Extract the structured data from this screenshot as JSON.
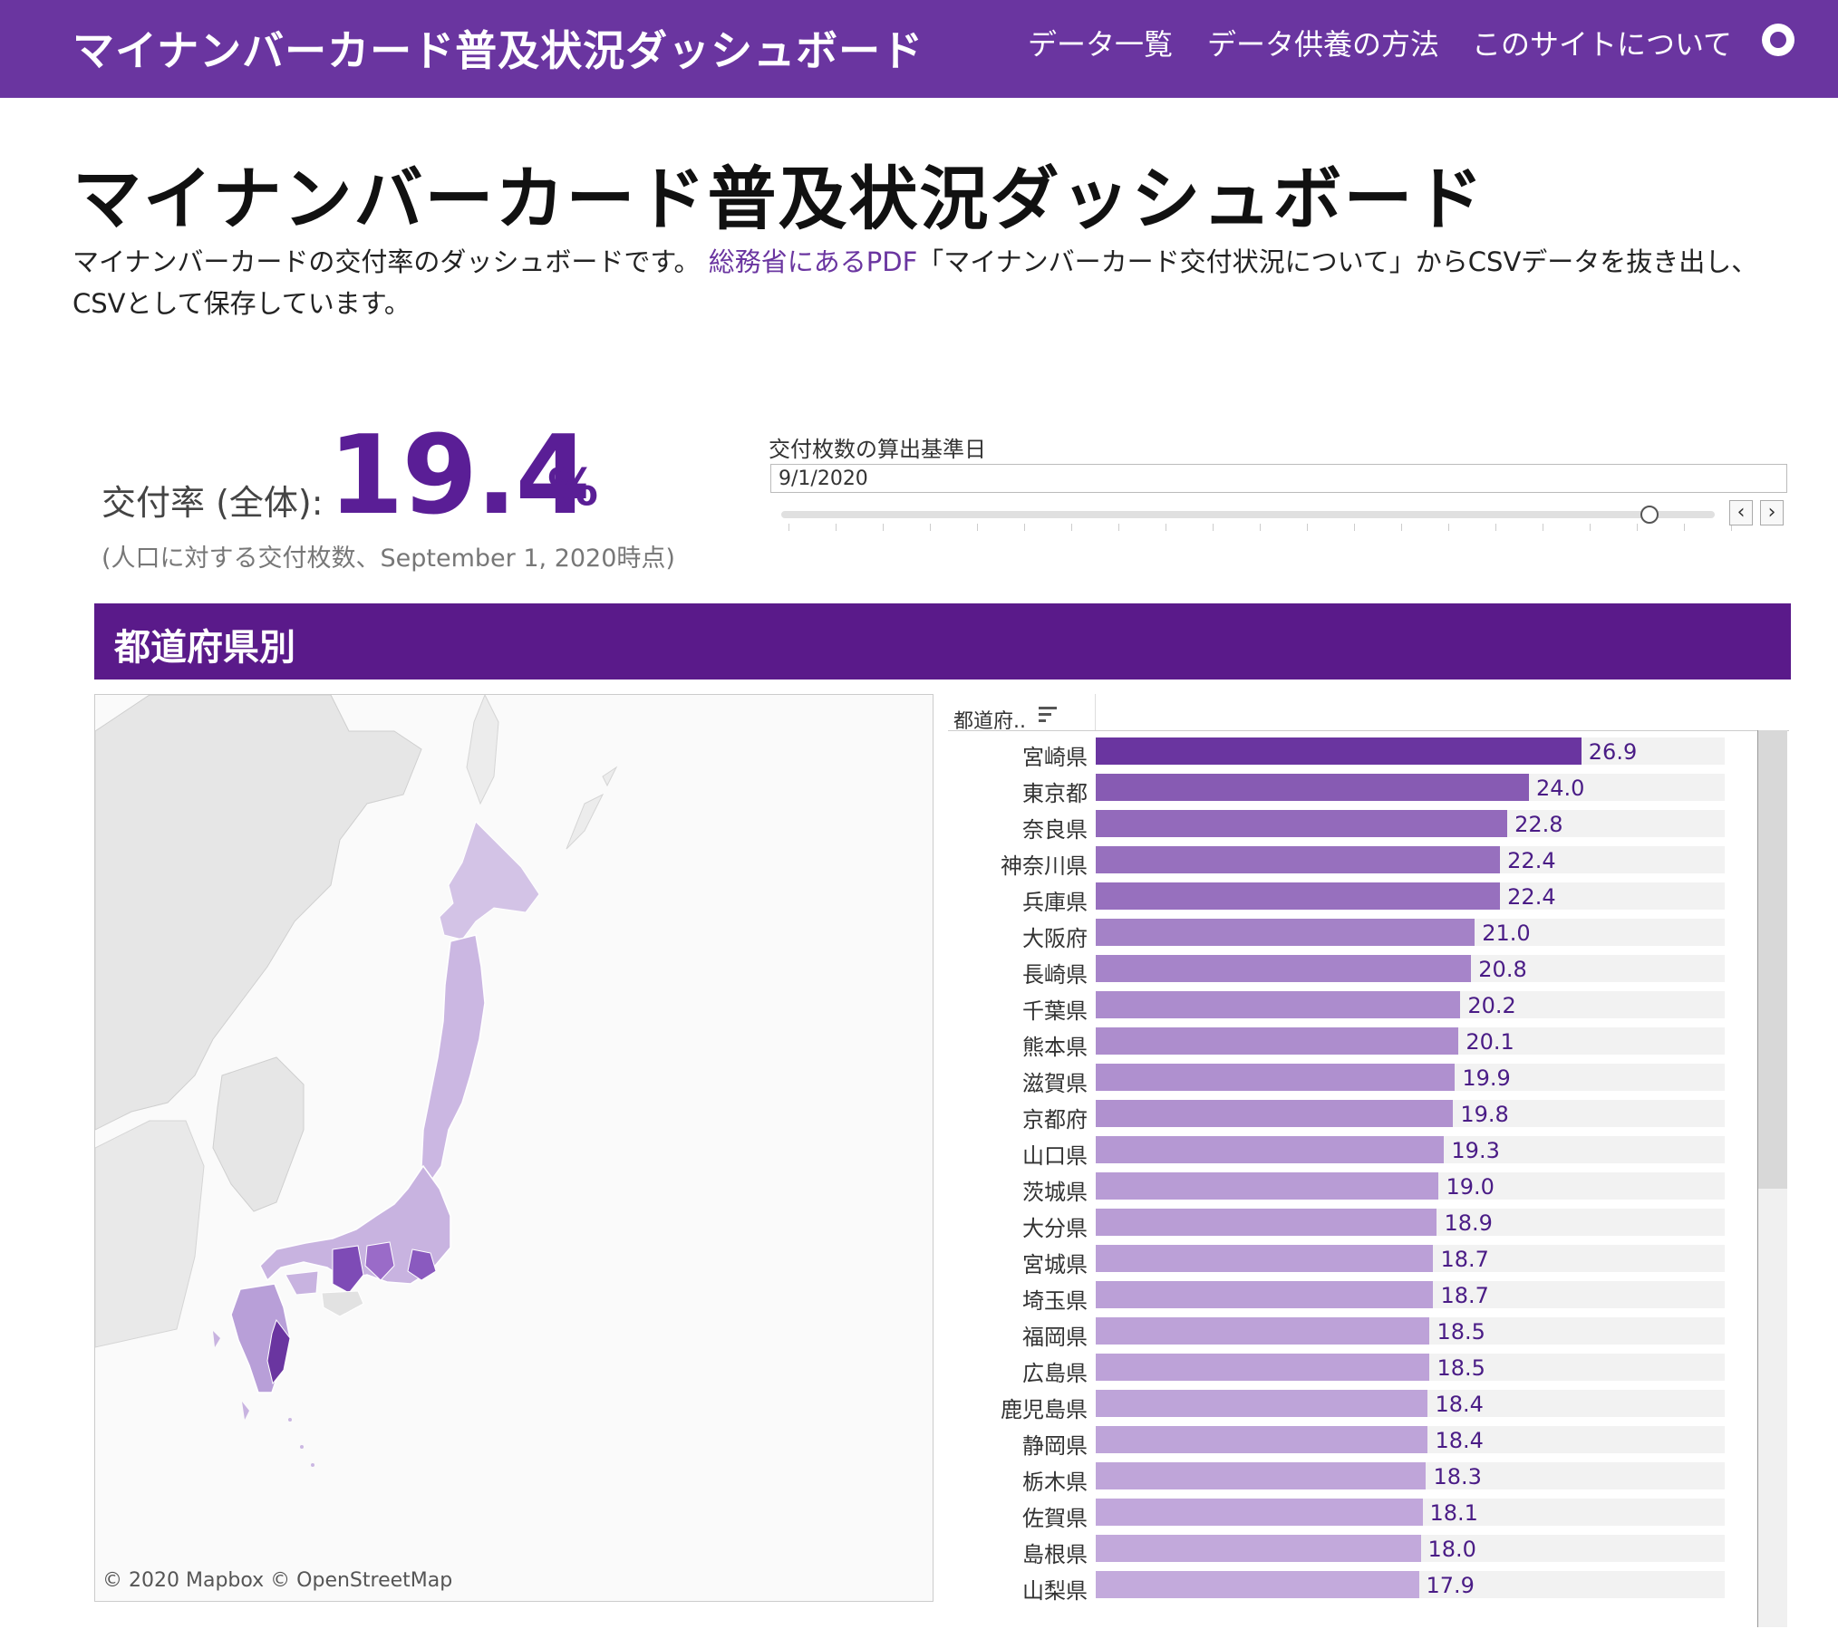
{
  "nav": {
    "brand": "マイナンバーカード普及状況ダッシュボード",
    "links": [
      "データ一覧",
      "データ供養の方法",
      "このサイトについて"
    ],
    "github_icon": "github-icon"
  },
  "page": {
    "title": "マイナンバーカード普及状況ダッシュボード",
    "desc_pre": "マイナンバーカードの交付率のダッシュボードです。",
    "desc_link": "総務省にあるPDF",
    "desc_post": "「マイナンバーカード交付状況について」からCSVデータを抜き出し、CSVとして保存しています。"
  },
  "kpi": {
    "label": "交付率 (全体):",
    "value": "19.4",
    "unit": "%",
    "note": "(人口に対する交付枚数、September 1, 2020時点)"
  },
  "date_filter": {
    "label": "交付枚数の算出基準日",
    "value": "9/1/2020",
    "prev_label": "‹",
    "next_label": "›",
    "slider_position": 0.93
  },
  "section": {
    "title": "都道府県別"
  },
  "map": {
    "attribution": "© 2020 Mapbox  © OpenStreetMap"
  },
  "bar_list": {
    "header": "都道府..",
    "sort_icon": "sort-descending-icon",
    "max": 100,
    "color_low": "#c3aadc",
    "color_high": "#6a35a0",
    "rows": [
      {
        "label": "宮崎県",
        "value": 26.9
      },
      {
        "label": "東京都",
        "value": 24.0
      },
      {
        "label": "奈良県",
        "value": 22.8
      },
      {
        "label": "神奈川県",
        "value": 22.4
      },
      {
        "label": "兵庫県",
        "value": 22.4
      },
      {
        "label": "大阪府",
        "value": 21.0
      },
      {
        "label": "長崎県",
        "value": 20.8
      },
      {
        "label": "千葉県",
        "value": 20.2
      },
      {
        "label": "熊本県",
        "value": 20.1
      },
      {
        "label": "滋賀県",
        "value": 19.9
      },
      {
        "label": "京都府",
        "value": 19.8
      },
      {
        "label": "山口県",
        "value": 19.3
      },
      {
        "label": "茨城県",
        "value": 19.0
      },
      {
        "label": "大分県",
        "value": 18.9
      },
      {
        "label": "宮城県",
        "value": 18.7
      },
      {
        "label": "埼玉県",
        "value": 18.7
      },
      {
        "label": "福岡県",
        "value": 18.5
      },
      {
        "label": "広島県",
        "value": 18.5
      },
      {
        "label": "鹿児島県",
        "value": 18.4
      },
      {
        "label": "静岡県",
        "value": 18.4
      },
      {
        "label": "栃木県",
        "value": 18.3
      },
      {
        "label": "佐賀県",
        "value": 18.1
      },
      {
        "label": "島根県",
        "value": 18.0
      },
      {
        "label": "山梨県",
        "value": 17.9
      }
    ]
  }
}
